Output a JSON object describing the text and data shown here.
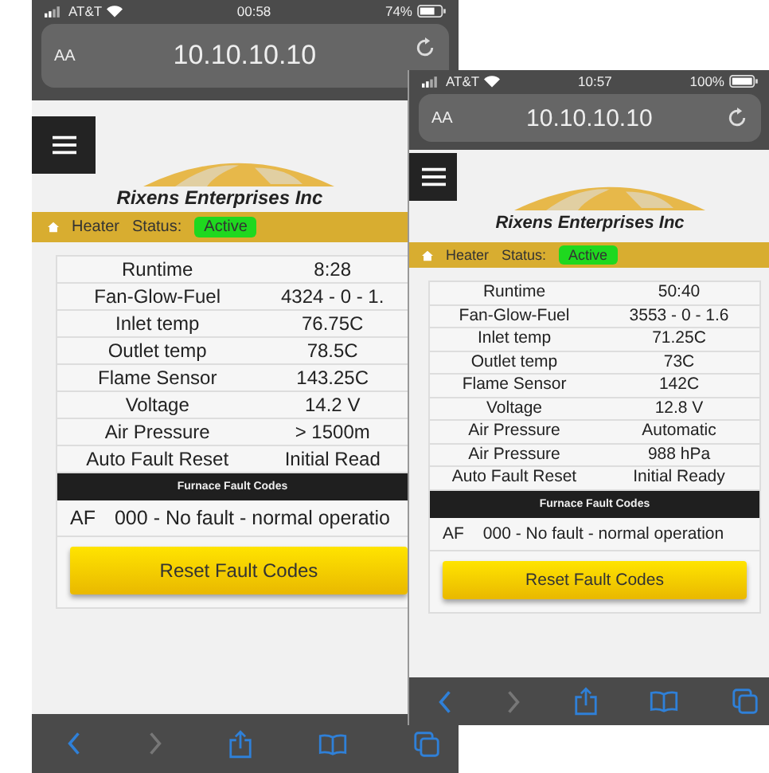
{
  "phones": [
    {
      "status_bar": {
        "carrier": "AT&T",
        "time": "00:58",
        "battery": "74%"
      },
      "address_bar": {
        "text_size": "AA",
        "url": "10.10.10.10"
      },
      "logo": "Rixens Enterprises Inc",
      "heater_bar": {
        "label": "Heater",
        "status_label": "Status:",
        "status": "Active"
      },
      "readings": [
        {
          "label": "Runtime",
          "value": "8:28"
        },
        {
          "label": "Fan-Glow-Fuel",
          "value": "4324 - 0 - 1."
        },
        {
          "label": "Inlet temp",
          "value": "76.75C"
        },
        {
          "label": "Outlet temp",
          "value": "78.5C"
        },
        {
          "label": "Flame Sensor",
          "value": "143.25C"
        },
        {
          "label": "Voltage",
          "value": "14.2 V"
        },
        {
          "label": "Air Pressure",
          "value": "> 1500m"
        },
        {
          "label": "Auto Fault Reset",
          "value": "Initial Read"
        }
      ],
      "fault_header": "Furnace Fault Codes",
      "faults": [
        {
          "code": "AF",
          "text": "000 - No fault - normal operatio"
        }
      ],
      "button": "Reset Fault Codes"
    },
    {
      "status_bar": {
        "carrier": "AT&T",
        "time": "10:57",
        "battery": "100%"
      },
      "address_bar": {
        "text_size": "AA",
        "url": "10.10.10.10"
      },
      "logo": "Rixens Enterprises Inc",
      "heater_bar": {
        "label": "Heater",
        "status_label": "Status:",
        "status": "Active"
      },
      "readings": [
        {
          "label": "Runtime",
          "value": "50:40"
        },
        {
          "label": "Fan-Glow-Fuel",
          "value": "3553 - 0 - 1.6"
        },
        {
          "label": "Inlet temp",
          "value": "71.25C"
        },
        {
          "label": "Outlet temp",
          "value": "73C"
        },
        {
          "label": "Flame Sensor",
          "value": "142C"
        },
        {
          "label": "Voltage",
          "value": "12.8 V"
        },
        {
          "label": "Air Pressure",
          "value": "Automatic"
        },
        {
          "label": "Air Pressure",
          "value": "988 hPa"
        },
        {
          "label": "Auto Fault Reset",
          "value": "Initial Ready"
        }
      ],
      "fault_header": "Furnace Fault Codes",
      "faults": [
        {
          "code": "AF",
          "text": "000 - No fault - normal operation"
        }
      ],
      "button": "Reset Fault Codes"
    }
  ]
}
